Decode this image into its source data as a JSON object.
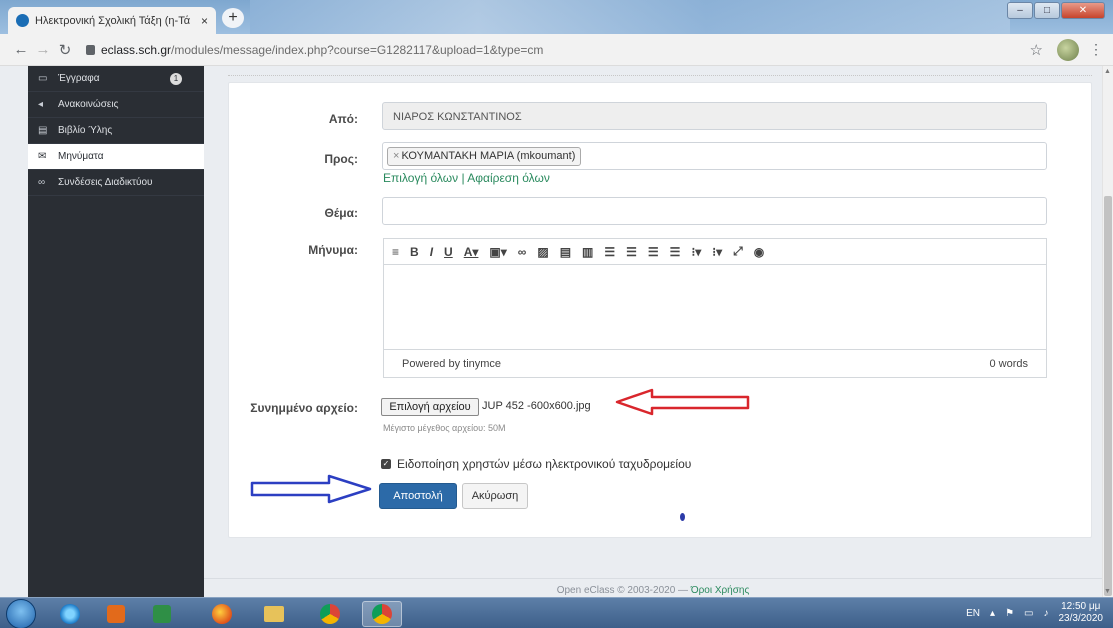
{
  "browser": {
    "tab_title": "Ηλεκτρονική Σχολική Τάξη (η-Τά",
    "tab_close": "×",
    "new_tab": "+",
    "url_host": "eclass.sch.gr",
    "url_path": "/modules/message/index.php?course=G1282117&upload=1&type=cm",
    "win_min": "–",
    "win_max": "□",
    "win_close": "✕"
  },
  "sidebar": {
    "items": [
      {
        "label": "Έγγραφα",
        "icon": "folder-icon",
        "badge": "1"
      },
      {
        "label": "Ανακοινώσεις",
        "icon": "megaphone-icon"
      },
      {
        "label": "Βιβλίο Ύλης",
        "icon": "calendar-icon"
      },
      {
        "label": "Μηνύματα",
        "icon": "envelope-icon",
        "active": true
      },
      {
        "label": "Συνδέσεις Διαδικτύου",
        "icon": "link-icon"
      }
    ]
  },
  "form": {
    "from_label": "Από:",
    "from_value": "ΝΙΑΡΟΣ ΚΩΝΣΤΑΝΤΙΝΟΣ",
    "to_label": "Προς:",
    "to_tag": "ΚΟΥΜΑΝΤΑΚΗ ΜΑΡΙΑ (mkoumant)",
    "select_all": "Επιλογή όλων",
    "separator": "|",
    "remove_all": "Αφαίρεση όλων",
    "subject_label": "Θέμα:",
    "subject_value": "",
    "message_label": "Μήνυμα:",
    "powered_by": "Powered by tinymce",
    "word_count": "0 words",
    "attachment_label": "Συνημμένο αρχείο:",
    "choose_file": "Επιλογή αρχείου",
    "file_name": "JUP 452   -600x600.jpg",
    "max_size": "Μέγιστο μέγεθος αρχείου: 50M",
    "notify_label": "Ειδοποίηση χρηστών μέσω ηλεκτρονικού ταχυδρομείου",
    "notify_checked": true,
    "send_button": "Αποστολή",
    "cancel_button": "Ακύρωση"
  },
  "footer": {
    "text": "Open eClass © 2003-2020 — ",
    "terms": "Όροι Χρήσης"
  },
  "taskbar": {
    "lang": "EN",
    "time": "12:50 μμ",
    "date": "23/3/2020"
  },
  "colors": {
    "sidebar_bg": "#2a2e34",
    "primary_button": "#2c6aa8",
    "link": "#2a8a5e",
    "annotation_red": "#d9262c",
    "annotation_blue": "#2c3fc2"
  }
}
